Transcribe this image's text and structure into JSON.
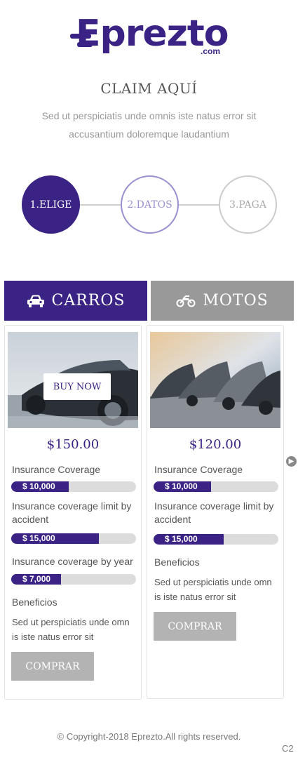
{
  "brand": {
    "name": "Eprezto",
    "domain_suffix": ".com",
    "color": "#3a2384"
  },
  "header": {
    "title": "CLAIM AQUÍ",
    "subtitle": "Sed ut perspiciatis unde omnis iste natus error sit accusantium doloremque laudantium"
  },
  "steps": [
    {
      "label": "1.ELIGE",
      "state": "active"
    },
    {
      "label": "2.DATOS",
      "state": "next"
    },
    {
      "label": "3.PAGA",
      "state": "inactive"
    }
  ],
  "tabs": [
    {
      "label": "CARROS",
      "icon": "car-icon",
      "active": true
    },
    {
      "label": "MOTOS",
      "icon": "motorcycle-icon",
      "active": false
    }
  ],
  "cards": [
    {
      "buy_now": "BUY NOW",
      "price": "$150.00",
      "coverage_label": "Insurance Coverage",
      "coverage_value": "$ 10,000",
      "coverage_fill": 0.46,
      "limit_label": "Insurance coverage limit by accident",
      "limit_value": "$ 15,000",
      "limit_fill": 0.7,
      "year_label": "Insurance coverage by year",
      "year_value": "$ 7,000",
      "year_fill": 0.4,
      "benefits_label": "Beneficios",
      "benefits_text": "Sed ut perspiciatis unde omn is iste natus error sit",
      "button": "COMPRAR"
    },
    {
      "price": "$120.00",
      "coverage_label": "Insurance Coverage",
      "coverage_value": "$ 10,000",
      "coverage_fill": 0.46,
      "limit_label": "Insurance coverage limit by accident",
      "limit_value": "$ 15,000",
      "limit_fill": 0.56,
      "benefits_label": "Beneficios",
      "benefits_text": "Sed ut perspiciatis unde omn is iste natus error sit",
      "button": "COMPRAR"
    }
  ],
  "footer": {
    "copyright": "© Copyright-2018 Eprezto.All rights reserved.",
    "corner": "C2"
  }
}
